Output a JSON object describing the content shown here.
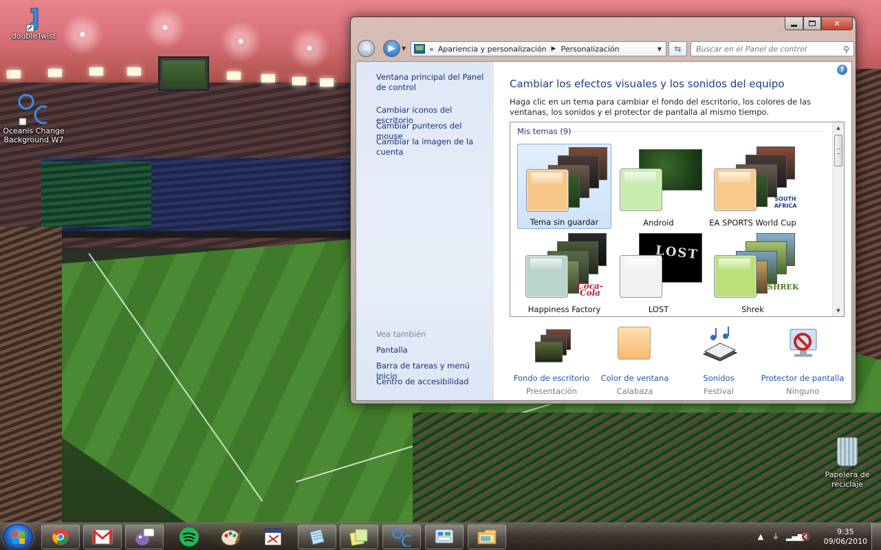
{
  "desktop": {
    "icons": [
      {
        "label": "doubleTwist",
        "icon": "doubletwist-icon"
      },
      {
        "label": "Oceanis Change Background W7",
        "icon": "oceanis-icon"
      }
    ],
    "recycle_bin": {
      "label": "Papelera de reciclaje",
      "icon": "recycle-bin-icon"
    }
  },
  "window": {
    "breadcrumb": {
      "overflow": "«",
      "items": [
        "Apariencia y personalización",
        "Personalización"
      ],
      "separator": "▶"
    },
    "search": {
      "placeholder": "Buscar en el Panel de control"
    },
    "left_pane": {
      "links": [
        "Ventana principal del Panel de control",
        "Cambiar iconos del escritorio",
        "Cambiar punteros del mouse",
        "Cambiar la imagen de la cuenta"
      ],
      "see_also_heading": "Vea también",
      "see_also_links": [
        "Pantalla",
        "Barra de tareas y menú Inicio",
        "Centro de accesibilidad"
      ]
    },
    "main": {
      "title": "Cambiar los efectos visuales y los sonidos del equipo",
      "description": "Haga clic en un tema para cambiar el fondo del escritorio, los colores de las ventanas, los sonidos y el protector de pantalla al mismo tiempo.",
      "group_label": "Mis temas (9)",
      "themes": [
        {
          "name": "Tema sin guardar",
          "selected": true,
          "swatch_color": "#f6c98a"
        },
        {
          "name": "Android",
          "selected": false,
          "swatch_color": "#c8ecb0"
        },
        {
          "name": "EA SPORTS World Cup",
          "selected": false,
          "swatch_color": "#f9c98c",
          "badge": "SOUTH AFRICA"
        },
        {
          "name": "Happiness Factory",
          "selected": false,
          "swatch_color": "#b8d4cc",
          "badge": "Coca-Cola"
        },
        {
          "name": "LOST",
          "selected": false,
          "swatch_color": "#f2f2f2",
          "art_text": "LOST"
        },
        {
          "name": "Shrek",
          "selected": false,
          "swatch_color": "#b9e07a",
          "badge": "SHREK"
        }
      ],
      "bottom": [
        {
          "label": "Fondo de escritorio",
          "value": "Presentación",
          "icon": "desktop-background-icon"
        },
        {
          "label": "Color de ventana",
          "value": "Calabaza",
          "icon": "window-color-icon"
        },
        {
          "label": "Sonidos",
          "value": "Festival",
          "icon": "sounds-icon"
        },
        {
          "label": "Protector de pantalla",
          "value": "Ninguno",
          "icon": "screensaver-icon"
        }
      ]
    }
  },
  "taskbar": {
    "pinned": [
      "chrome-icon",
      "gmail-icon",
      "pidgin-icon",
      "spotify-icon",
      "paint-icon",
      "screenshot-tool-icon",
      "notepad-icon",
      "sticky-notes-icon",
      "oceanis-icon",
      "control-panel-icon",
      "explorer-icon"
    ],
    "clock": {
      "time": "9:35",
      "date": "09/06/2010"
    }
  },
  "colors": {
    "link": "#14317a",
    "title": "#1e3a8a",
    "accent": "#1a56b4"
  }
}
